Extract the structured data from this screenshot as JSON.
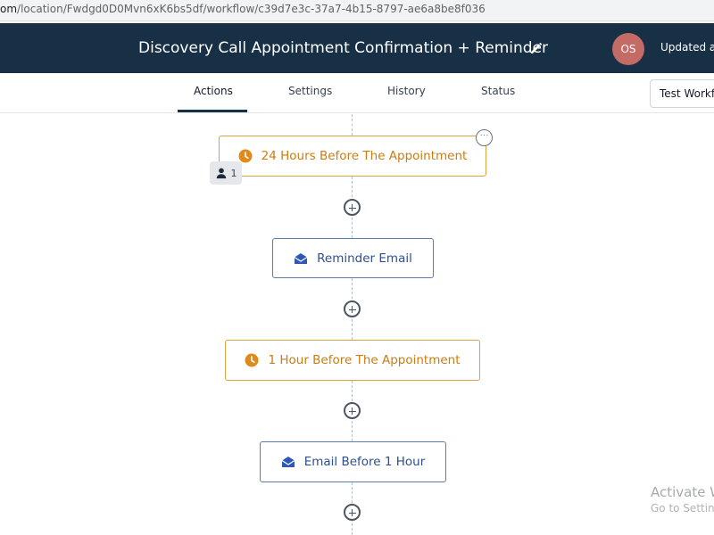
{
  "browser": {
    "url_host": "om",
    "url_path": "/location/Fwdgd0D0Mvn6xK6bs5df/workflow/c39d7e3c-37a7-4b15-8797-ae6a8be8f036"
  },
  "header": {
    "title": "Discovery Call Appointment Confirmation + Reminder",
    "avatar_initials": "OS",
    "updated_text": "Updated at",
    "background": "#183045"
  },
  "tabs": [
    {
      "label": "Actions",
      "active": true
    },
    {
      "label": "Settings",
      "active": false
    },
    {
      "label": "History",
      "active": false
    },
    {
      "label": "Status",
      "active": false
    }
  ],
  "test_button": {
    "label": "Test Workflow"
  },
  "workflow": {
    "steps": [
      {
        "type": "wait",
        "icon": "clock-icon",
        "label": "24 Hours Before The Appointment",
        "contacts_count": "1",
        "more_icon": "ellipsis-icon"
      },
      {
        "type": "email",
        "icon": "envelope-icon",
        "label": "Reminder Email"
      },
      {
        "type": "wait",
        "icon": "clock-icon",
        "label": "1 Hour Before The Appointment"
      },
      {
        "type": "email",
        "icon": "envelope-icon",
        "label": "Email Before 1 Hour"
      }
    ],
    "colors": {
      "wait": "#d9a441",
      "email": "#5b7bb4"
    }
  },
  "watermark": {
    "line1": "Activate W",
    "line2": "Go to Settin"
  }
}
